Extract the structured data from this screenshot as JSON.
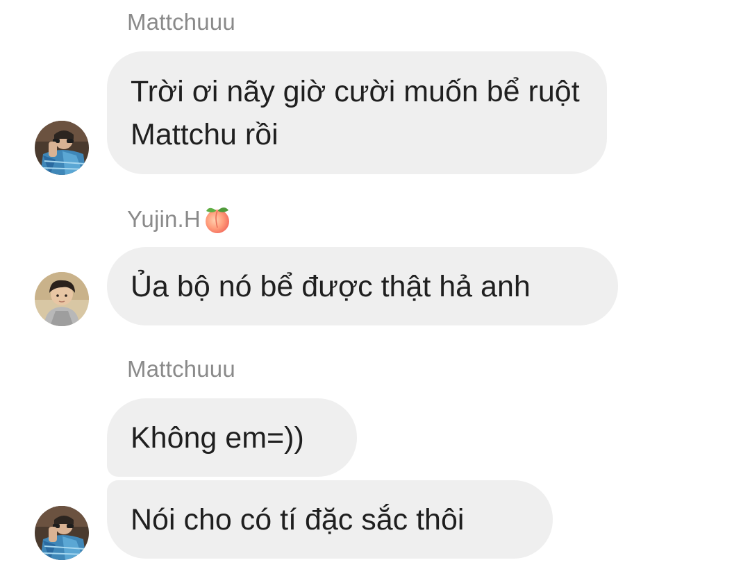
{
  "messages": [
    {
      "sender": "Mattchuuu",
      "text": "Trời ơi nãy giờ cười muốn bể ruột Mattchu rồi"
    },
    {
      "sender": "Yujin.H",
      "sender_emoji": "peach-emoji",
      "text": "Ủa bộ nó bể được thật hả anh"
    },
    {
      "sender": "Mattchuuu",
      "text": "Không em=))"
    },
    {
      "text": "Nói cho có tí đặc sắc thôi"
    }
  ],
  "colors": {
    "bubble": "#efefef",
    "sender_text": "#8a8a8a",
    "message_text": "#1f1f1f"
  }
}
